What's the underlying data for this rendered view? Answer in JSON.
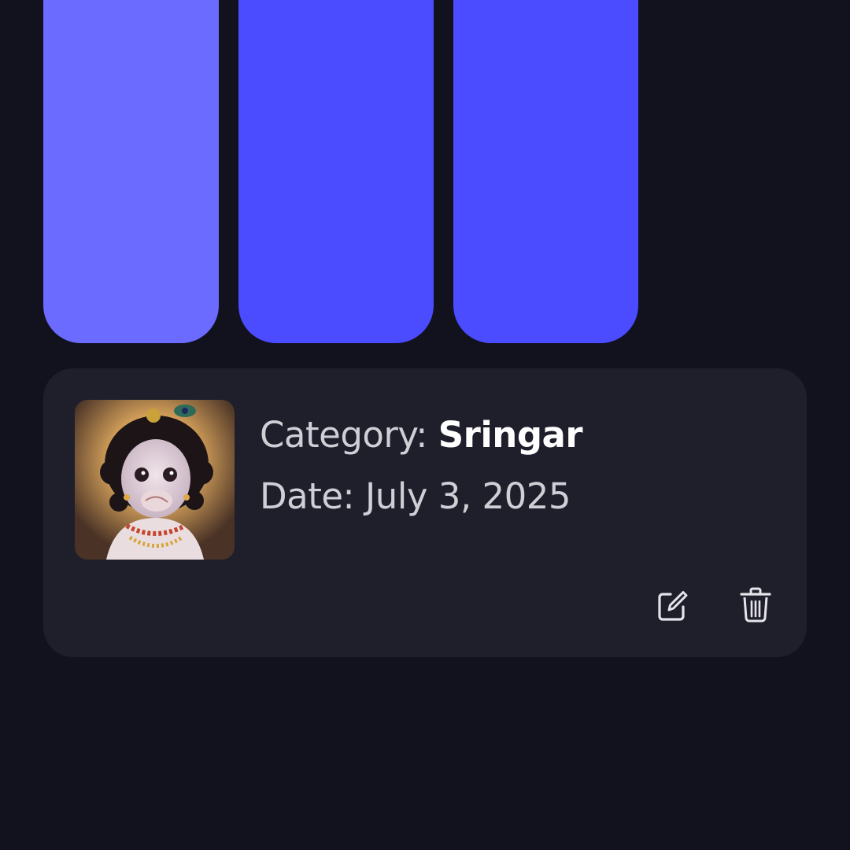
{
  "colors": {
    "background": "#12111e",
    "card": "#1f1e2b",
    "block_light": "#6b6bff",
    "block_primary": "#4b4bff",
    "icon": "#e4e4ea"
  },
  "entry": {
    "category_label": "Category:",
    "category_value": "Sringar",
    "date_label": "Date:",
    "date_value": "July 3, 2025",
    "thumbnail_icon": "deity-portrait-image",
    "edit_icon": "edit-icon",
    "delete_icon": "trash-icon"
  }
}
